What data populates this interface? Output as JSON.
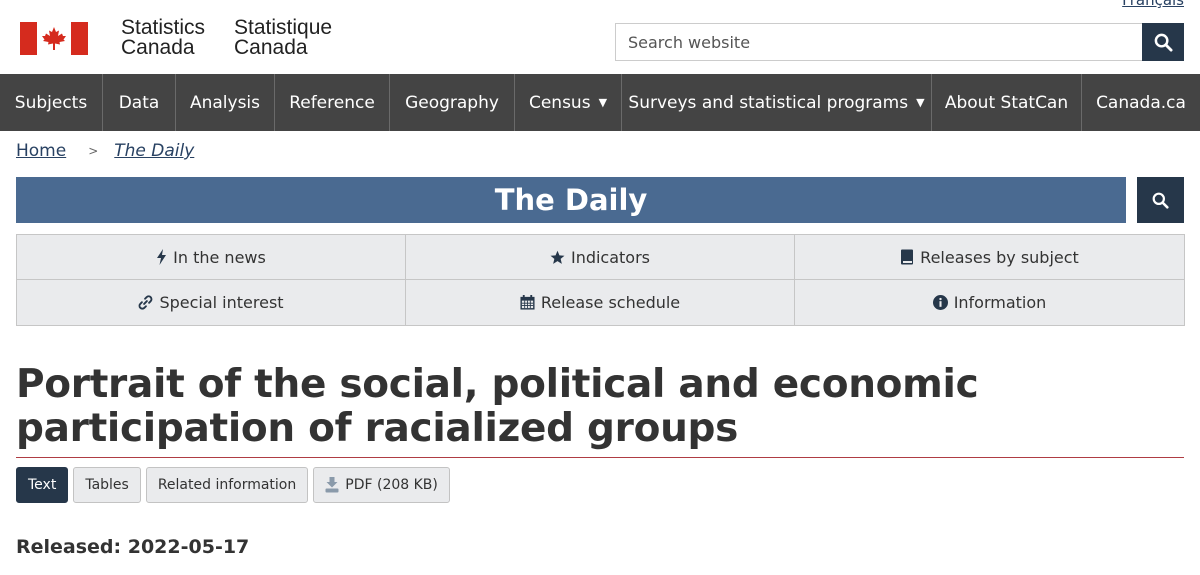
{
  "header": {
    "language_link": "Français",
    "wordmark_en_line1": "Statistics",
    "wordmark_en_line2": "Canada",
    "wordmark_fr_line1": "Statistique",
    "wordmark_fr_line2": "Canada",
    "search_placeholder": "Search website",
    "search_icon": "search-icon"
  },
  "menu": {
    "items": [
      {
        "label": "Subjects"
      },
      {
        "label": "Data"
      },
      {
        "label": "Analysis"
      },
      {
        "label": "Reference"
      },
      {
        "label": "Geography"
      },
      {
        "label": "Census",
        "dropdown": true
      },
      {
        "label": "Surveys and statistical programs",
        "dropdown": true
      },
      {
        "label": "About StatCan"
      },
      {
        "label": "Canada.ca"
      }
    ]
  },
  "breadcrumb": {
    "separator": ">",
    "items": [
      {
        "label": "Home"
      },
      {
        "label": "The Daily"
      }
    ]
  },
  "daily": {
    "banner_title": "The Daily",
    "nav": [
      {
        "label": "In the news",
        "icon": "bolt-icon"
      },
      {
        "label": "Indicators",
        "icon": "star-icon"
      },
      {
        "label": "Releases by subject",
        "icon": "book-icon"
      },
      {
        "label": "Special interest",
        "icon": "link-icon"
      },
      {
        "label": "Release schedule",
        "icon": "calendar-icon"
      },
      {
        "label": "Information",
        "icon": "info-icon"
      }
    ]
  },
  "article": {
    "title": "Portrait of the social, political and economic participation of racialized groups",
    "tabs": [
      {
        "label": "Text",
        "active": true
      },
      {
        "label": "Tables"
      },
      {
        "label": "Related information"
      },
      {
        "label": "PDF (208 KB)",
        "icon": "download-pdf-icon"
      }
    ],
    "released": "Released: 2022-05-17"
  },
  "colors": {
    "menu_bg": "#444444",
    "banner_bg": "#4a6a91",
    "dark_navy": "#26374a",
    "flag_red": "#d52b1e",
    "title_rule": "#af3c43",
    "nav_cell_bg": "#eaebed"
  }
}
